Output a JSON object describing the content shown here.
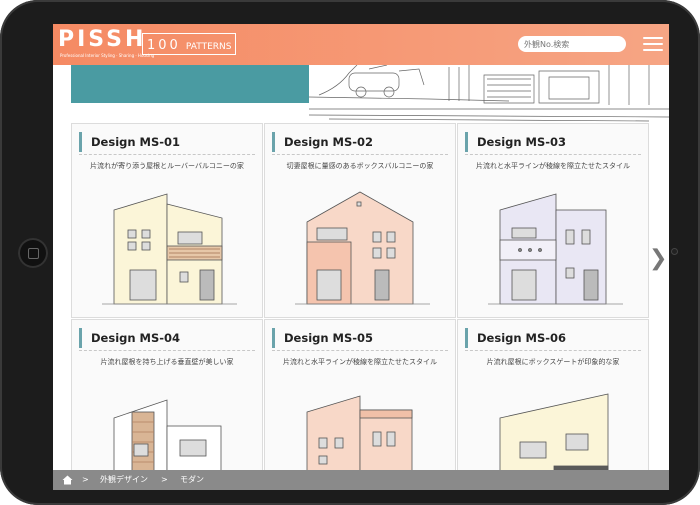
{
  "header": {
    "logo_text": "PISSH",
    "logo_subtitle": "Professional Interior Styling · Sharing · Housing",
    "patterns_number": "100",
    "patterns_word": "PATTERNS",
    "search_placeholder": "外観No.検索",
    "menu_icon": "hamburger-menu-icon"
  },
  "colors": {
    "header_accent": "#f58a63",
    "title_bar": "#6aa3ab",
    "hero_teal": "#4a9ba2",
    "breadcrumb_bg": "#8a8a8a"
  },
  "designs": [
    {
      "title": "Design MS-01",
      "desc": "片流れが寄り添う屋根とルーバーバルコニーの家",
      "color": "#fbf5d8"
    },
    {
      "title": "Design MS-02",
      "desc": "切妻屋根に量感のあるボックスバルコニーの家",
      "color": "#f8d8c8"
    },
    {
      "title": "Design MS-03",
      "desc": "片流れと水平ラインが稜線を際立たせたスタイル",
      "color": "#e9e7f4"
    },
    {
      "title": "Design MS-04",
      "desc": "片流れ屋根を持ち上げる垂直壁が美しい家",
      "color": "#ffffff"
    },
    {
      "title": "Design MS-05",
      "desc": "片流れと水平ラインが稜線を際立たせたスタイル",
      "color": "#f8d8c8"
    },
    {
      "title": "Design MS-06",
      "desc": "片流れ屋根にボックスゲートが印象的な家",
      "color": "#fbf5d8"
    }
  ],
  "navigation": {
    "next_icon": "chevron-right-icon",
    "next_glyph": "❯"
  },
  "breadcrumb": {
    "home_icon": "home-icon",
    "separator": ">",
    "item1": "外観デザイン",
    "item2": "モダン"
  }
}
